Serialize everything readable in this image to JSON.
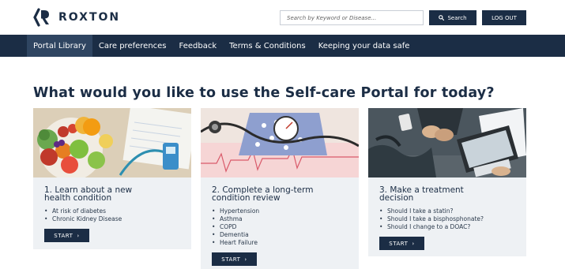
{
  "header": {
    "brand": "ROXTON",
    "search_placeholder": "Search by Keyword or Disease...",
    "search_label": "Search",
    "logout_label": "LOG OUT"
  },
  "nav": {
    "items": [
      {
        "label": "Portal Library",
        "active": true
      },
      {
        "label": "Care preferences"
      },
      {
        "label": "Feedback"
      },
      {
        "label": "Terms & Conditions"
      },
      {
        "label": "Keeping your data safe"
      }
    ]
  },
  "main": {
    "title": "What would you like to use the Self-care Portal for today?",
    "cards": [
      {
        "title_line1": "1. Learn about a new",
        "title_line2": "health condition",
        "items": [
          "At risk of diabetes",
          "Chronic Kidney Disease"
        ],
        "button": "START"
      },
      {
        "title_line1": "2. Complete a long-term",
        "title_line2": "condition review",
        "items": [
          "Hypertension",
          "Asthma",
          "COPD",
          "Dementia",
          "Heart Failure"
        ],
        "button": "START"
      },
      {
        "title_line1": "3. Make a treatment",
        "title_line2": "decision",
        "items": [
          "Should I take a statin?",
          "Should I take a bisphosphonate?",
          "Should I change to a DOAC?"
        ],
        "button": "START"
      }
    ]
  },
  "colors": {
    "brand": "#1b2d45",
    "nav_active": "#2f4561",
    "card_bg": "#eef1f4"
  },
  "icons": {
    "logo": "roxton-logo-icon",
    "search": "search-icon",
    "button_arrow": "chevron-right-icon"
  }
}
